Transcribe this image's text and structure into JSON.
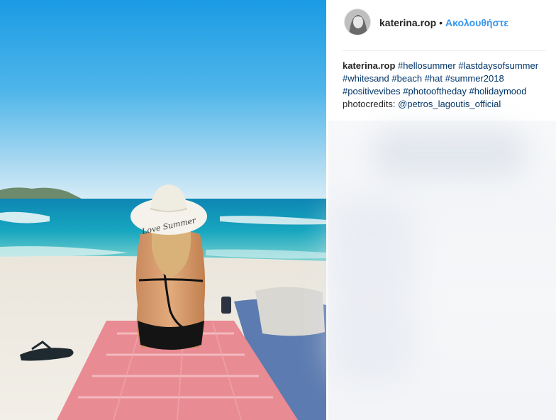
{
  "post": {
    "username": "katerina.rop",
    "separator": "•",
    "follow_label": "Ακολουθήστε",
    "caption": {
      "username": "katerina.rop",
      "hashtags": [
        "#hellosummer",
        "#lastdaysofsummer",
        "#whitesand",
        "#beach",
        "#hat",
        "#summer2018",
        "#positivevibes",
        "#photooftheday",
        "#holidaymood"
      ],
      "text": "photocredits:",
      "mention": "@petros_lagoutis_official"
    },
    "hat_text": "Love Summer"
  },
  "colors": {
    "sky_top": "#1d9fe6",
    "sky_bottom": "#d6ecf6",
    "sea": "#1e9fb8",
    "towel": "#e8888f",
    "link": "#3897f0",
    "hashtag": "#003569"
  }
}
